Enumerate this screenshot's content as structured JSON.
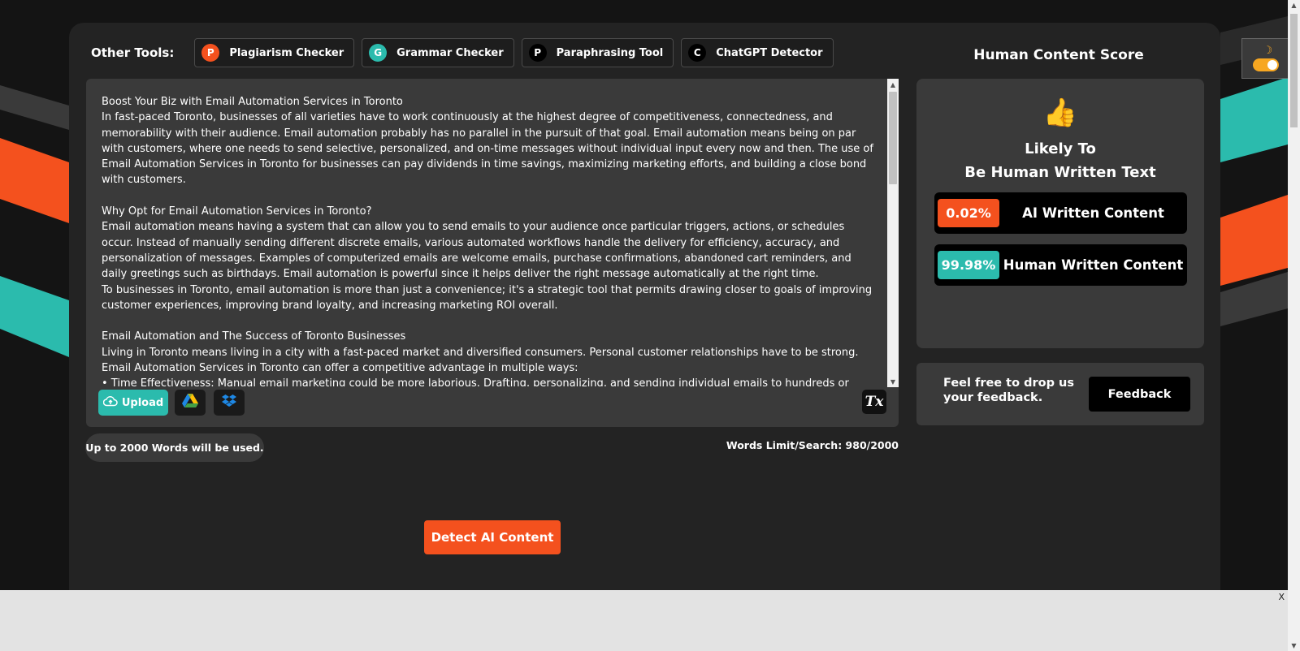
{
  "tools": {
    "label": "Other Tools:",
    "items": [
      {
        "icon_letter": "P",
        "icon_color": "#f4511e",
        "label": "Plagiarism Checker"
      },
      {
        "icon_letter": "G",
        "icon_color": "#2bbbad",
        "label": "Grammar Checker"
      },
      {
        "icon_letter": "P",
        "icon_color": "#000000",
        "label": "Paraphrasing Tool"
      },
      {
        "icon_letter": "C",
        "icon_color": "#000000",
        "label": "ChatGPT Detector"
      }
    ]
  },
  "editor": {
    "lines": [
      "Boost Your Biz with Email Automation Services in Toronto",
      "In fast-paced Toronto, businesses of all varieties have to work continuously at the highest degree of competitiveness, connectedness, and memorability with their audience. Email automation probably has no parallel in the pursuit of that goal. Email automation means being on par with customers, where one needs to send selective, personalized, and on-time messages without individual input every now and then. The use of Email Automation Services in Toronto for businesses can pay dividends in time savings, maximizing marketing efforts, and building a close bond with customers.",
      "",
      "Why Opt for Email Automation Services in Toronto?",
      "Email automation means having a system that can allow you to send emails to your audience once particular triggers, actions, or schedules occur. Instead of manually sending different discrete emails, various automated workflows handle the delivery for efficiency, accuracy, and personalization of messages. Examples of computerized emails are welcome emails, purchase confirmations, abandoned cart reminders, and daily greetings such as birthdays. Email automation is powerful since it helps deliver the right message automatically at the right time.",
      "To businesses in Toronto, email automation is more than just a convenience; it's a strategic tool that permits drawing closer to goals of improving customer experiences, improving brand loyalty, and increasing marketing ROI overall.",
      "",
      "Email Automation and The Success of Toronto Businesses",
      "Living in Toronto means living in a city with a fast-paced market and diversified consumers. Personal customer relationships have to be strong. Email Automation Services in Toronto can offer a competitive advantage in multiple ways:",
      "•      Time Effectiveness: Manual email marketing could be more laborious. Drafting, personalizing, and sending individual emails to hundreds or thousands of clients is just not practical. Email automation services will help track and automate these communications for businesses, saving this precious time for doing"
    ],
    "upload_label": "Upload",
    "clear_label": "Tx"
  },
  "limits": {
    "pill": "Up to 2000 Words will be used.",
    "count": "Words Limit/Search: 980/2000"
  },
  "detect_label": "Detect AI Content",
  "score": {
    "title": "Human Content Score",
    "thumb": "👍",
    "verdict_line1": "Likely To",
    "verdict_line2": "Be Human Written Text",
    "ai_percent": "0.02%",
    "ai_label": "AI Written Content",
    "ai_color": "#f4511e",
    "human_percent": "99.98%",
    "human_label": "Human Written Content",
    "human_color": "#2bbbad"
  },
  "feedback": {
    "text": "Feel free to drop us your feedback.",
    "button": "Feedback"
  },
  "theme_toggle": {
    "moon": "☽"
  },
  "ad": {
    "close": "X"
  }
}
